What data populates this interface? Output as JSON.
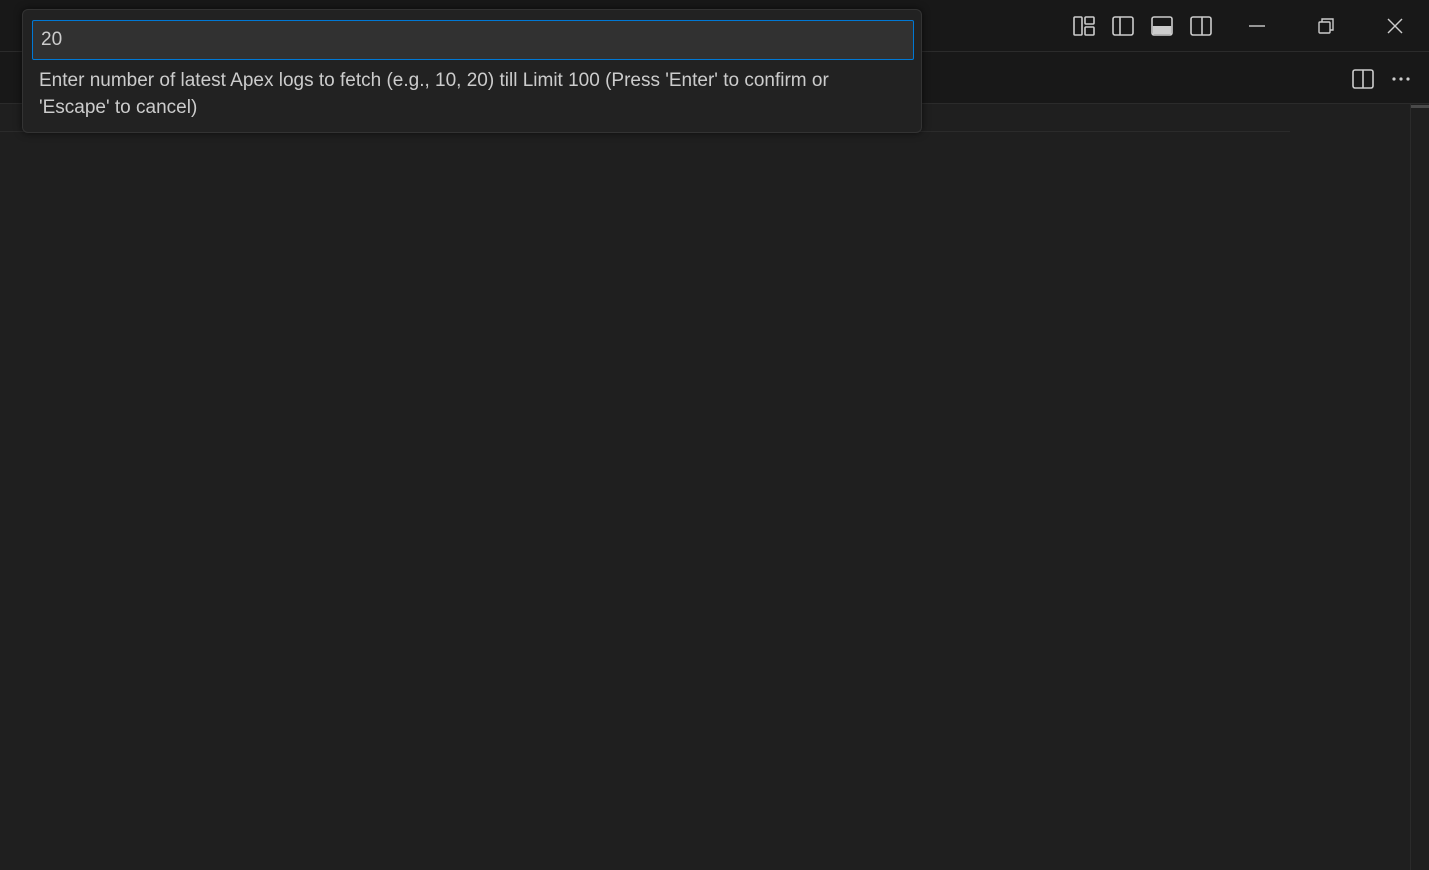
{
  "quick_input": {
    "value": "20",
    "message": "Enter number of latest Apex logs to fetch (e.g., 10, 20) till Limit 100 (Press 'Enter' to confirm or 'Escape' to cancel)"
  },
  "titlebar": {
    "layout_icons": [
      "customize-layout-icon",
      "toggle-primary-sidebar-icon",
      "toggle-panel-icon",
      "toggle-secondary-sidebar-icon"
    ],
    "window_controls": [
      "minimize-icon",
      "restore-icon",
      "close-icon"
    ]
  },
  "tabbar": {
    "actions": [
      "split-editor-icon",
      "more-actions-icon"
    ]
  },
  "colors": {
    "background": "#1f1f1f",
    "chrome": "#181818",
    "focus_border": "#0078d4",
    "input_background": "#313131",
    "foreground": "#cccccc"
  }
}
